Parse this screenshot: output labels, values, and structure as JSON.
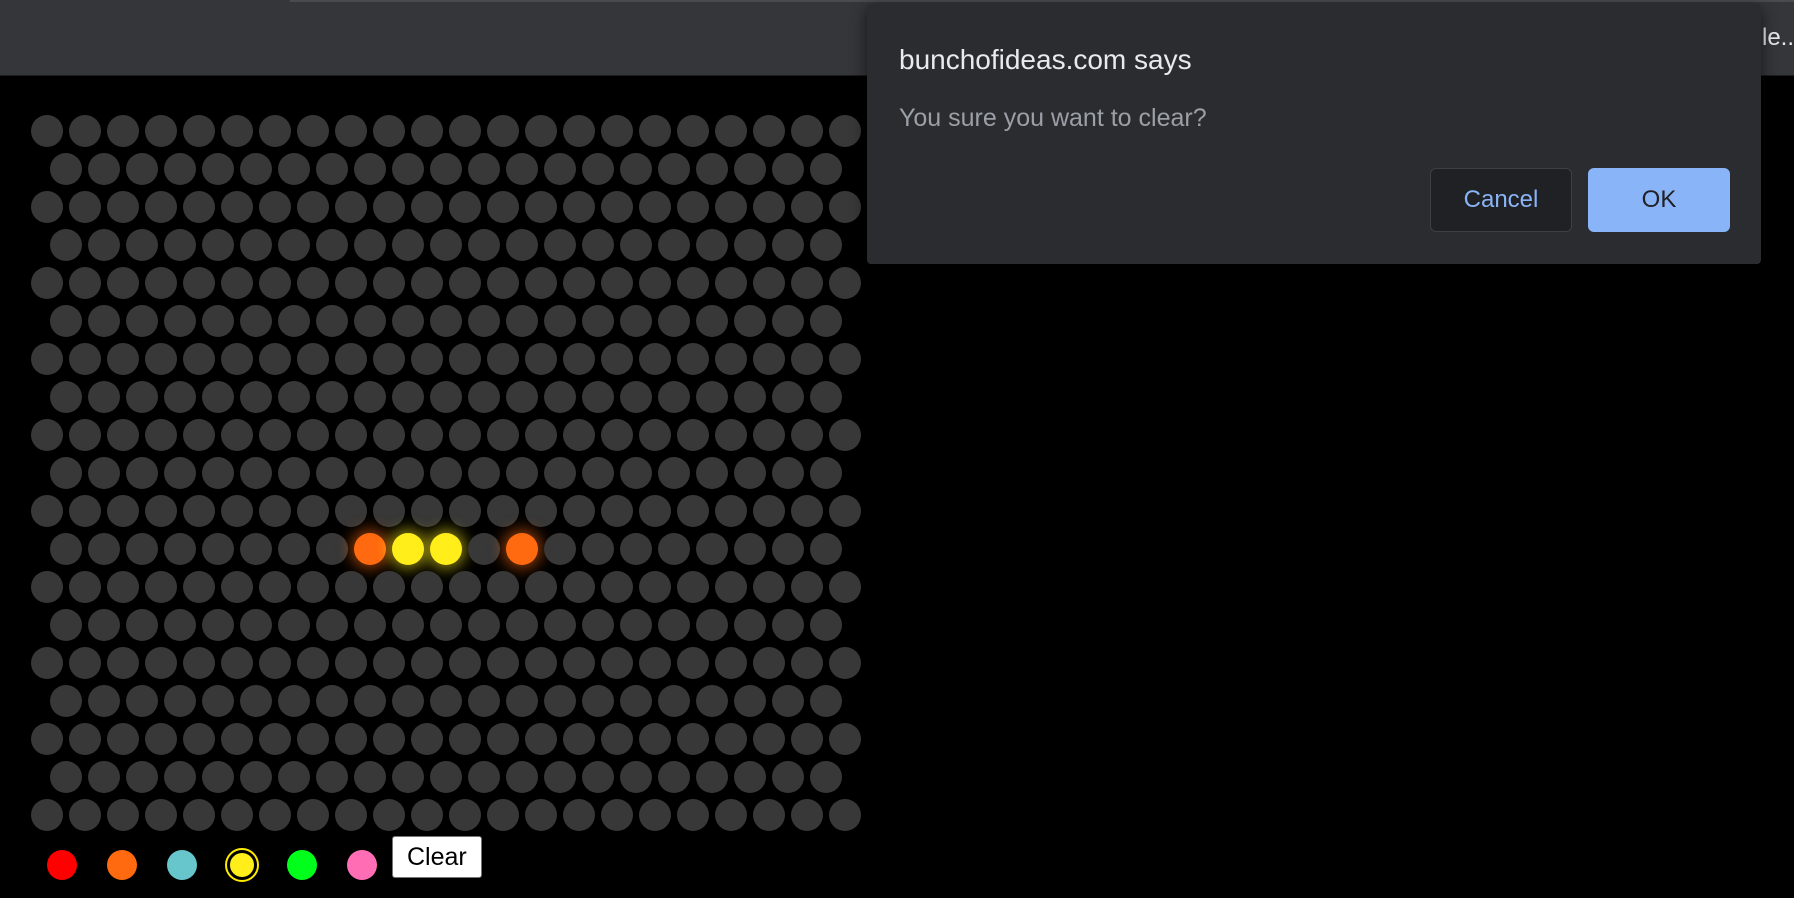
{
  "browser": {
    "title_fragment": "le.."
  },
  "board": {
    "peg_color": "#383838",
    "rows": 19,
    "cols_wide": 22,
    "cols_narrow": 21,
    "lit_pegs": [
      {
        "row": 11,
        "col": 8,
        "color": "#ff6a10"
      },
      {
        "row": 11,
        "col": 9,
        "color": "#ffee1a"
      },
      {
        "row": 11,
        "col": 10,
        "color": "#ffee1a"
      },
      {
        "row": 11,
        "col": 12,
        "color": "#ff6a10"
      }
    ]
  },
  "palette": {
    "selected": "yellow",
    "swatches": [
      {
        "name": "red",
        "color": "#ff0000"
      },
      {
        "name": "orange",
        "color": "#ff6a10"
      },
      {
        "name": "teal",
        "color": "#66c6cc"
      },
      {
        "name": "yellow",
        "color": "#ffee1a"
      },
      {
        "name": "green",
        "color": "#00ff1a"
      },
      {
        "name": "pink",
        "color": "#ff6eb4"
      }
    ],
    "clear_label": "Clear"
  },
  "dialog": {
    "title": "bunchofideas.com says",
    "message": "You sure you want to clear?",
    "cancel_label": "Cancel",
    "ok_label": "OK"
  }
}
